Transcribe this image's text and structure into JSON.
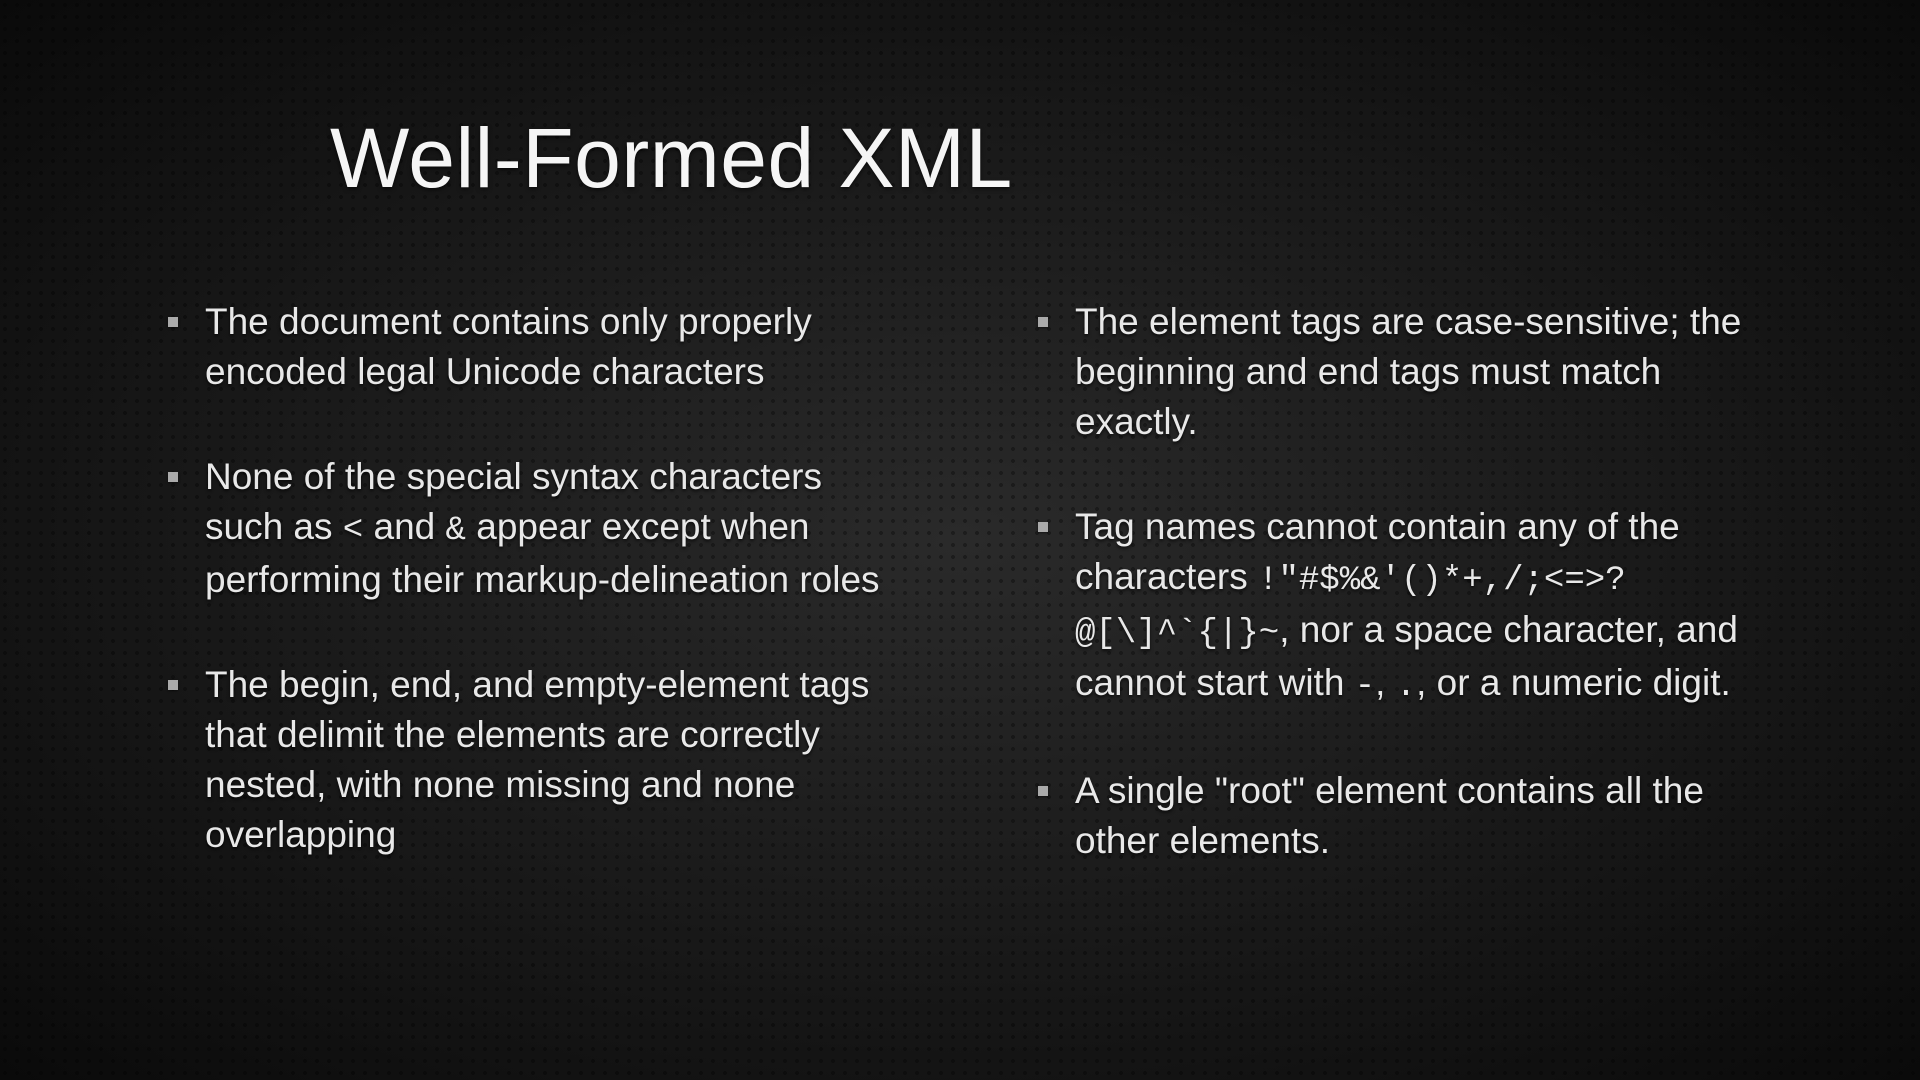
{
  "title": "Well-Formed XML",
  "left_bullets": [
    {
      "text": "The document contains only properly encoded legal Unicode characters"
    },
    {
      "parts": [
        {
          "t": "None of the special syntax characters such as "
        },
        {
          "t": "<",
          "mono": true
        },
        {
          "t": " and "
        },
        {
          "t": "&",
          "mono": true
        },
        {
          "t": " appear except when performing their markup-delineation roles"
        }
      ]
    },
    {
      "text": "The begin, end, and empty-element tags that delimit the elements are correctly nested, with none missing and none overlapping"
    }
  ],
  "right_bullets": [
    {
      "text": "The element tags are case-sensitive; the beginning and end tags must match exactly."
    },
    {
      "parts": [
        {
          "t": "Tag names cannot contain any of the characters "
        },
        {
          "t": "!\"#$%&'()*+,/;<=>?@[\\]^`{|}~",
          "mono": true
        },
        {
          "t": ", nor a space character, and cannot start with "
        },
        {
          "t": "-",
          "mono": true
        },
        {
          "t": ", "
        },
        {
          "t": ".",
          "mono": true
        },
        {
          "t": ", or a numeric digit."
        }
      ]
    },
    {
      "text": "A single \"root\" element contains all the other elements."
    }
  ]
}
